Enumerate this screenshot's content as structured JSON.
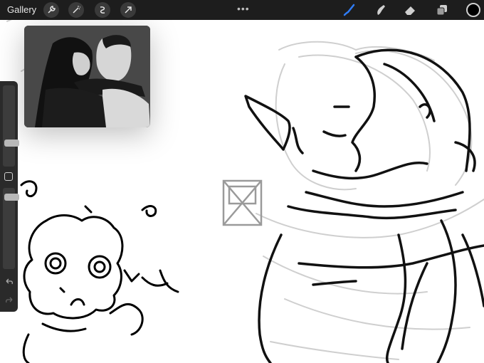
{
  "toolbar": {
    "gallery_label": "Gallery",
    "left_tools": [
      "wrench-icon",
      "magic-wand-icon",
      "selection-icon",
      "transform-arrow-icon"
    ],
    "more_label": "•••",
    "right_tools": [
      "brush-icon",
      "smudge-icon",
      "eraser-icon",
      "layers-icon"
    ],
    "active_tool": "brush-icon",
    "accent_color": "#2f7cf6",
    "current_color": "#000000"
  },
  "sidebar": {
    "size_slider_value": 0.27,
    "opacity_slider_value": 0.52,
    "undo_icon": "undo-icon",
    "redo_icon": "redo-icon"
  },
  "reference_window": {
    "icon": "reference-photo"
  }
}
